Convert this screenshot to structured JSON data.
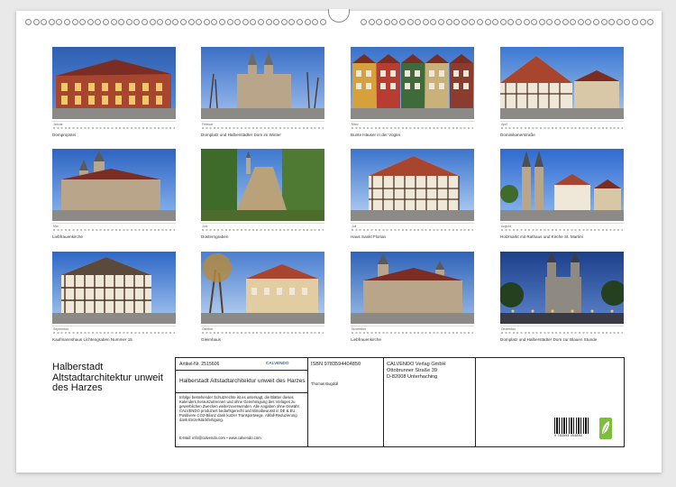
{
  "calendar": {
    "title": "Halberstadt Altstadtarchitektur unweit des Harzes",
    "months": [
      {
        "name": "Januar",
        "caption": "Dompropstei",
        "scene": "building-dusk"
      },
      {
        "name": "Februar",
        "caption": "Domplatz und Halberstädter Dom im Winter",
        "scene": "cathedral-winter"
      },
      {
        "name": "März",
        "caption": "Bunte Häuser in der Vogtei",
        "scene": "colorful-houses"
      },
      {
        "name": "April",
        "caption": "Dominikanerstraße",
        "scene": "timber-street"
      },
      {
        "name": "Mai",
        "caption": "Liebfrauenkirche",
        "scene": "church-blue"
      },
      {
        "name": "Juni",
        "caption": "Düsterngraben",
        "scene": "green-path"
      },
      {
        "name": "Juli",
        "caption": "Haus Sankt Florian",
        "scene": "timber-house"
      },
      {
        "name": "August",
        "caption": "Holzmarkt mit Rathaus und Kirche St. Martini",
        "scene": "square-towers"
      },
      {
        "name": "September",
        "caption": "Kaufmannshaus Lichtengraben Nummer 15",
        "scene": "timber-corner"
      },
      {
        "name": "Oktober",
        "caption": "Gleimhaus",
        "scene": "autumn-house"
      },
      {
        "name": "November",
        "caption": "Liebfrauenkirche",
        "scene": "church-evening"
      },
      {
        "name": "Dezember",
        "caption": "Domplatz und Halberstädter Dom zur Blauen Stunde",
        "scene": "cathedral-night"
      }
    ]
  },
  "info": {
    "article_no": "Artikel-Nr. 2515606",
    "publisher_logo": "CALVENDO",
    "product_title": "Halberstadt Altstadtarchitektur unweit des Harzes",
    "legal_text": "Infolge bestehender Schutzrechte ist es untersagt, die Blätter dieses Kalenders herauszutrennen und ohne Genehmigung des Verlages zu gewerblichen Zwecken weiterzuverwenden. Alle Angaben ohne Gewähr. CALVENDO produziert bedarfsgerecht und klimabewusst in DE & EU. Positivere CO2-Bilanz dank kurzer Transportwege. Abfall-Reduzierung dank Einzelstückfertigung.",
    "contact": "E-Mail: info@calvendo.com • www.calvendo.com",
    "isbn": "ISBN 9783594404850",
    "author": "Thomas Bugdoll",
    "publisher_name": "CALVENDO Verlag GmbH",
    "publisher_street": "Ottobrunner Straße 39",
    "publisher_city": "D-82008 Unterhaching",
    "barcode_number": "9 783594 404850"
  },
  "colors": {
    "sky_blue": "#3f7fd6",
    "brick_red": "#a8452f",
    "eco_green": "#7bbf3a"
  }
}
